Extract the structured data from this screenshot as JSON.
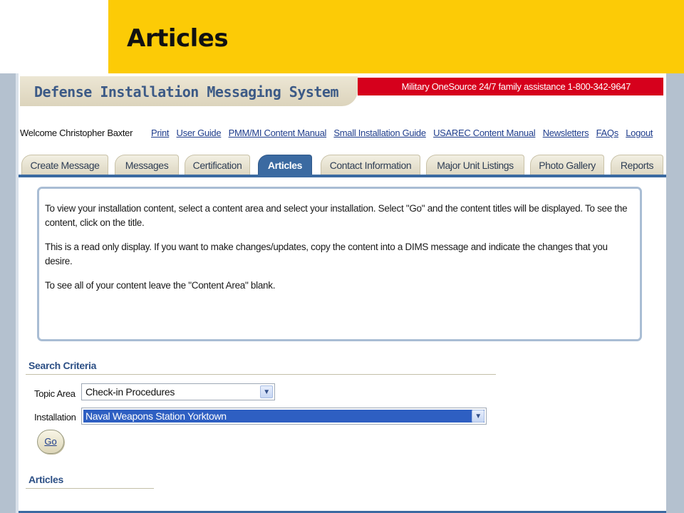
{
  "slide": {
    "title": "Articles"
  },
  "app": {
    "banner_title": "Defense Installation Messaging System",
    "assistance_text": "Military OneSource 24/7 family assistance 1-800-342-9647",
    "welcome_text": "Welcome Christopher Baxter",
    "links": [
      "Print",
      "User Guide",
      "PMM/MI Content Manual",
      "Small Installation Guide",
      "USAREC Content Manual",
      "Newsletters",
      "FAQs",
      "Logout"
    ],
    "tabs": [
      "Create Message",
      "Messages",
      "Certification",
      "Articles",
      "Contact Information",
      "Major Unit Listings",
      "Photo Gallery",
      "Reports"
    ],
    "active_tab": "Articles",
    "info": {
      "p1": "To view your installation content, select a content area and select your installation. Select \"Go\" and the content titles will be displayed. To see the content, click on the title.",
      "p2": "This is a read only display. If you want to make changes/updates, copy the content into a DIMS message and indicate the changes that you desire.",
      "p3": "To see all of your content leave the \"Content Area\" blank."
    },
    "search": {
      "heading": "Search Criteria",
      "topic_label": "Topic Area",
      "topic_value": "Check-in Procedures",
      "installation_label": "Installation",
      "installation_value": "Naval Weapons Station Yorktown",
      "go_label": "Go"
    },
    "articles_heading": "Articles"
  },
  "colors": {
    "slide_header": "#fccb06",
    "accent_blue": "#3b6aa1",
    "assist_red": "#d6001c",
    "link_blue": "#1f3d8c"
  },
  "icons": {
    "dropdown": "chevron-down-icon"
  }
}
